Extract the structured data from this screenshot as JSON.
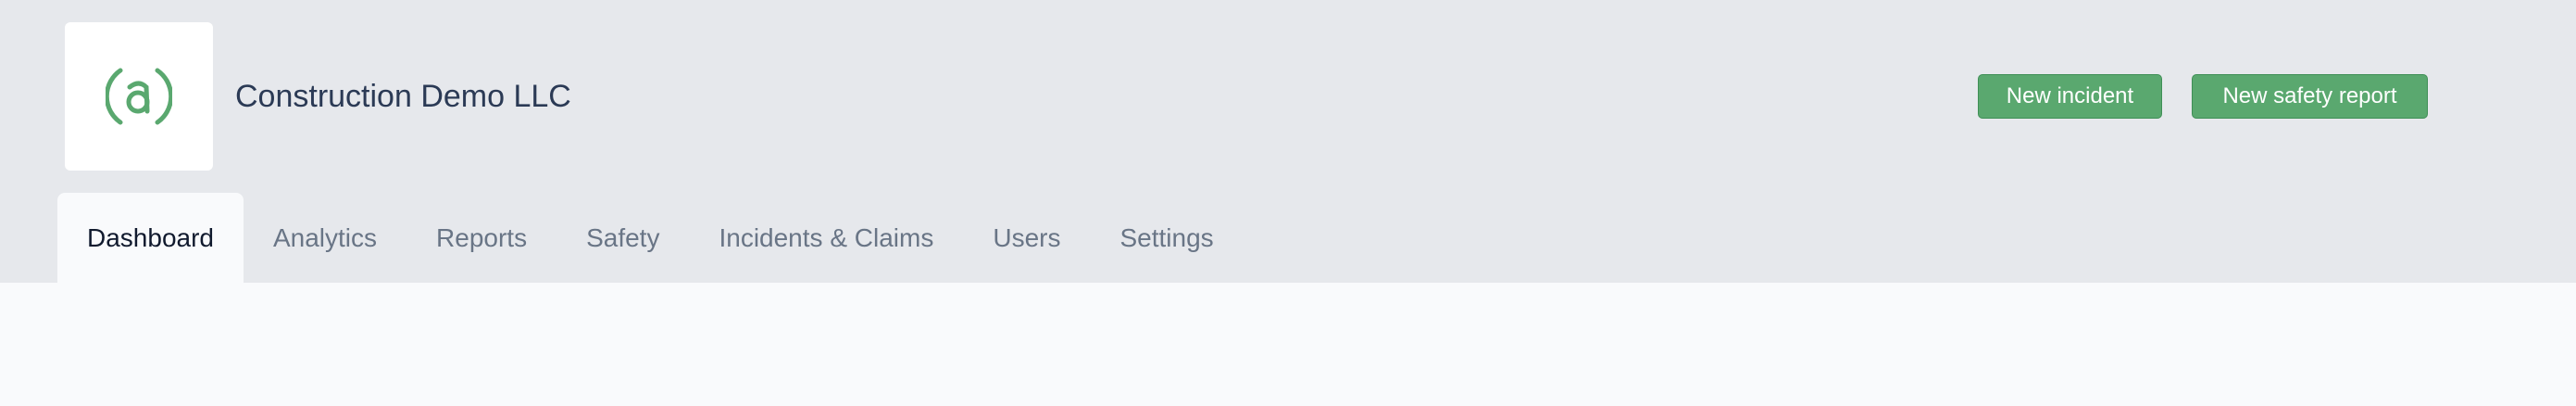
{
  "header": {
    "logo_icon": "at-sign-icon",
    "brand_color": "#5aa86f",
    "company_name": "Construction Demo LLC",
    "new_incident_label": "New incident",
    "new_safety_report_label": "New safety report"
  },
  "tabs": [
    {
      "label": "Dashboard",
      "active": true
    },
    {
      "label": "Analytics",
      "active": false
    },
    {
      "label": "Reports",
      "active": false
    },
    {
      "label": "Safety",
      "active": false
    },
    {
      "label": "Incidents & Claims",
      "active": false
    },
    {
      "label": "Users",
      "active": false
    },
    {
      "label": "Settings",
      "active": false
    }
  ]
}
